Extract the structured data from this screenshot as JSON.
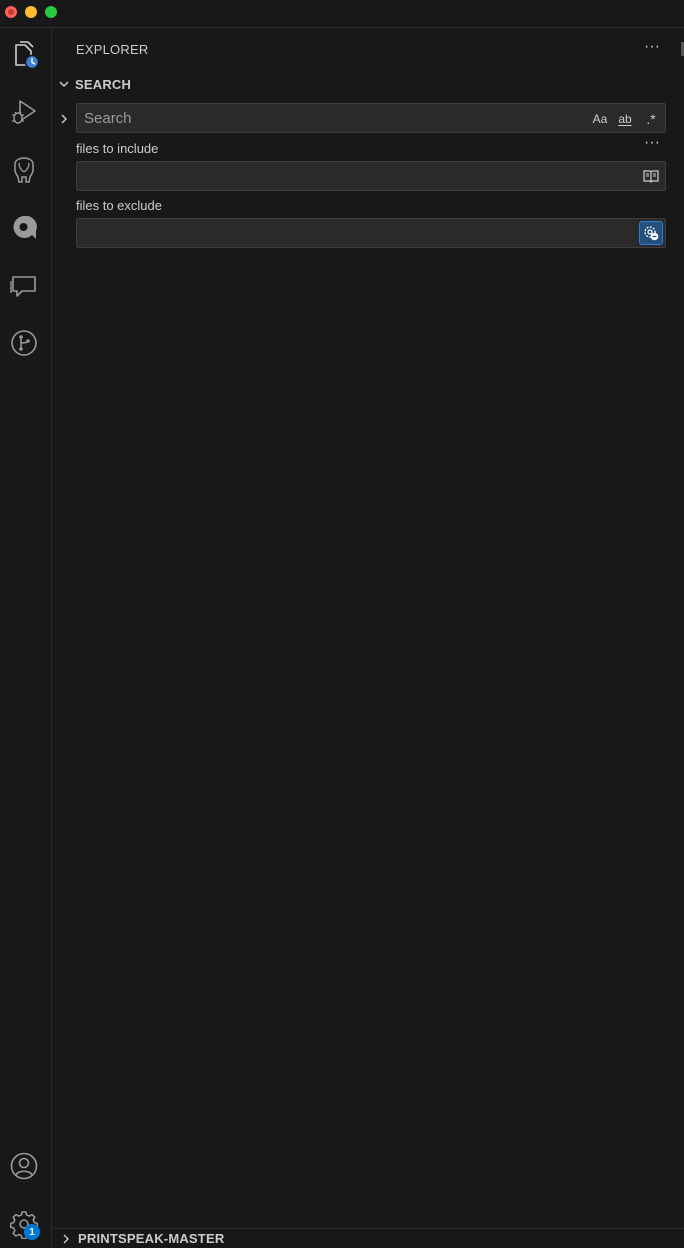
{
  "titlebar": {
    "buttons": [
      "close",
      "minimize",
      "maximize"
    ]
  },
  "activity_bar": {
    "items": [
      {
        "name": "explorer",
        "icon": "files-clock-icon"
      },
      {
        "name": "run-and-debug",
        "icon": "run-debug-icon"
      },
      {
        "name": "database",
        "icon": "elephant-icon"
      },
      {
        "name": "extension-q",
        "icon": "q-icon"
      },
      {
        "name": "chat",
        "icon": "chat-icon"
      },
      {
        "name": "source-control",
        "icon": "git-icon"
      }
    ],
    "bottom": [
      {
        "name": "accounts",
        "icon": "account-icon"
      },
      {
        "name": "manage",
        "icon": "gear-icon",
        "badge": "1"
      }
    ]
  },
  "sidebar": {
    "title": "EXPLORER",
    "search_section": {
      "title": "SEARCH",
      "search_placeholder": "Search",
      "search_value": "",
      "options": {
        "match_case": "Aa",
        "whole_word": "ab",
        "regex": ".*"
      },
      "include_label": "files to include",
      "include_value": "",
      "exclude_label": "files to exclude",
      "exclude_value": ""
    },
    "bottom_section": {
      "title": "PRINTSPEAK-MASTER"
    }
  },
  "colors": {
    "background": "#181818",
    "input_background": "#2a2a2a",
    "accent": "#0078d4",
    "active_toggle": "#24507d"
  }
}
